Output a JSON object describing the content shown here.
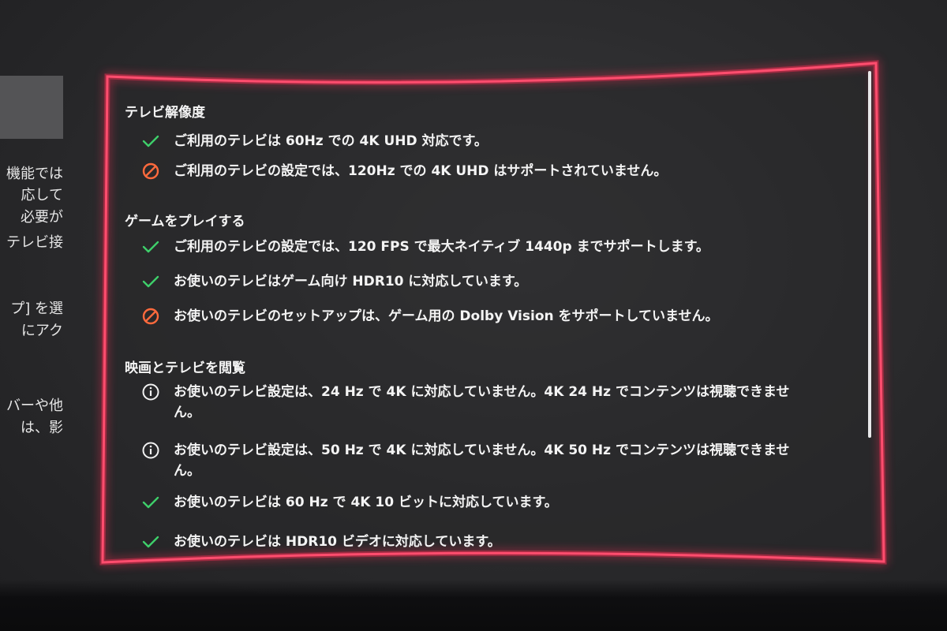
{
  "colors": {
    "frame_highlight": "#ff2d55",
    "check": "#3ecf6a",
    "blocked": "#ff6a3d",
    "info": "#f2f2f2",
    "text": "#f4f4f4"
  },
  "left_panel": {
    "lines": [
      "機能では",
      "応して",
      "必要が",
      "テレビ接",
      "プ] を選",
      "にアク",
      "バーや他",
      "は、影"
    ]
  },
  "sections": [
    {
      "title": "テレビ解像度",
      "items": [
        {
          "icon": "check-icon",
          "text": "ご利用のテレビは 60Hz での 4K UHD 対応です。"
        },
        {
          "icon": "blocked-icon",
          "text": "ご利用のテレビの設定では、120Hz での 4K UHD はサポートされていません。"
        }
      ]
    },
    {
      "title": "ゲームをプレイする",
      "items": [
        {
          "icon": "check-icon",
          "text": "ご利用のテレビの設定では、120 FPS で最大ネイティブ 1440p までサポートします。"
        },
        {
          "icon": "check-icon",
          "text": "お使いのテレビはゲーム向け HDR10 に対応しています。"
        },
        {
          "icon": "blocked-icon",
          "text": "お使いのテレビのセットアップは、ゲーム用の Dolby Vision をサポートしていません。"
        }
      ]
    },
    {
      "title": "映画とテレビを閲覧",
      "items": [
        {
          "icon": "info-icon",
          "text": "お使いのテレビ設定は、24 Hz で 4K に対応していません。4K 24 Hz でコンテンツは視聴できません。"
        },
        {
          "icon": "info-icon",
          "text": "お使いのテレビ設定は、50 Hz で 4K に対応していません。4K 50 Hz でコンテンツは視聴できません。"
        },
        {
          "icon": "check-icon",
          "text": "お使いのテレビは 60 Hz で 4K 10 ビットに対応しています。"
        },
        {
          "icon": "check-icon",
          "text": "お使いのテレビは HDR10 ビデオに対応しています。"
        }
      ]
    }
  ]
}
